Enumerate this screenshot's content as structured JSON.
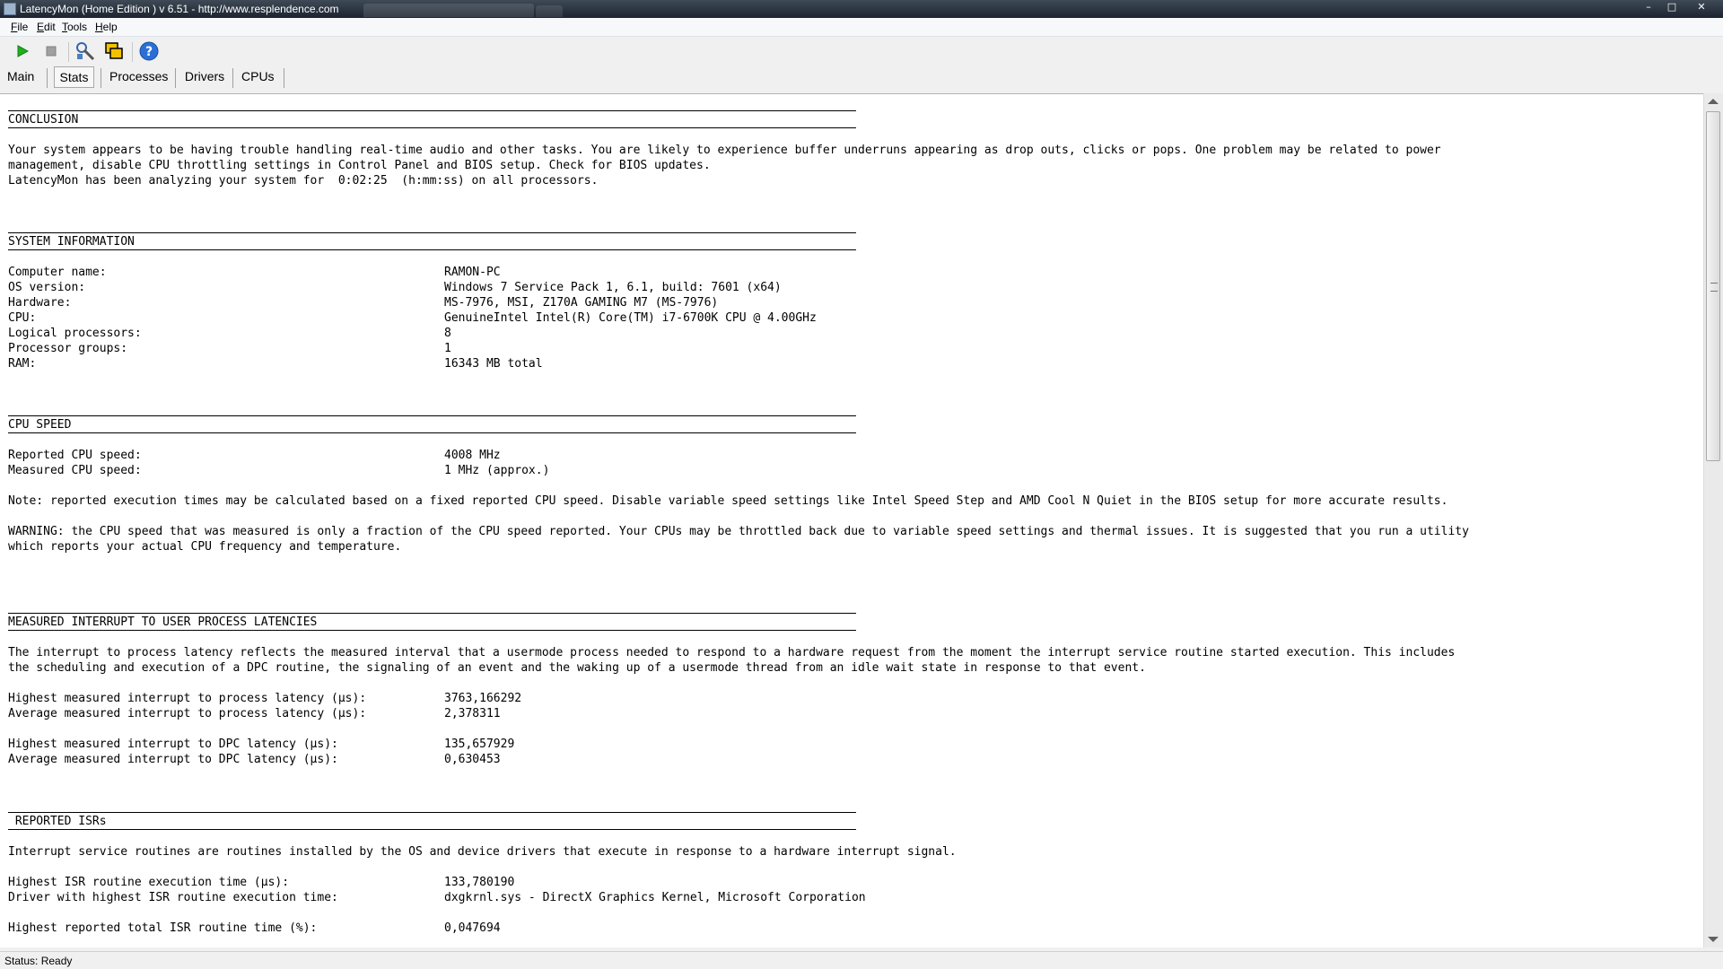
{
  "window": {
    "title": "LatencyMon  (Home Edition )  v 6.51 - http://www.resplendence.com",
    "controls": {
      "minimize": "–",
      "maximize": "□",
      "close": "✕"
    }
  },
  "menu": [
    {
      "label": "File"
    },
    {
      "label": "Edit"
    },
    {
      "label": "Tools"
    },
    {
      "label": "Help"
    }
  ],
  "toolbar": {
    "icons": [
      "play-icon",
      "stop-icon",
      "tools-icon",
      "windows-icon",
      "help-icon"
    ],
    "play_color": "#1fae1f",
    "help_color": "#2b6fd6"
  },
  "tabs": [
    {
      "label": "Main",
      "active": false
    },
    {
      "label": "Stats",
      "active": true
    },
    {
      "label": "Processes",
      "active": false
    },
    {
      "label": "Drivers",
      "active": false
    },
    {
      "label": "CPUs",
      "active": false
    }
  ],
  "report": {
    "conclusion": {
      "heading": "CONCLUSION",
      "line1": "Your system appears to be having trouble handling real-time audio and other tasks. You are likely to experience buffer underruns appearing as drop outs, clicks or pops. One problem may be related to power",
      "line2": "management, disable CPU throttling settings in Control Panel and BIOS setup. Check for BIOS updates.",
      "line3": "LatencyMon has been analyzing your system for  0:02:25  (h:mm:ss) on all processors."
    },
    "system_information": {
      "heading": "SYSTEM INFORMATION",
      "rows": [
        {
          "label": "Computer name:",
          "value": "RAMON-PC"
        },
        {
          "label": "OS version:",
          "value": "Windows 7 Service Pack 1, 6.1, build: 7601 (x64)"
        },
        {
          "label": "Hardware:",
          "value": "MS-7976, MSI, Z170A GAMING M7 (MS-7976)"
        },
        {
          "label": "CPU:",
          "value": "GenuineIntel Intel(R) Core(TM) i7-6700K CPU @ 4.00GHz"
        },
        {
          "label": "Logical processors:",
          "value": "8"
        },
        {
          "label": "Processor groups:",
          "value": "1"
        },
        {
          "label": "RAM:",
          "value": "16343 MB total"
        }
      ]
    },
    "cpu_speed": {
      "heading": "CPU SPEED",
      "rows": [
        {
          "label": "Reported CPU speed:",
          "value": "4008 MHz"
        },
        {
          "label": "Measured CPU speed:",
          "value": "1 MHz (approx.)"
        }
      ],
      "note": "Note: reported execution times may be calculated based on a fixed reported CPU speed. Disable variable speed settings like Intel Speed Step and AMD Cool N Quiet in the BIOS setup for more accurate results.",
      "warning1": "WARNING: the CPU speed that was measured is only a fraction of the CPU speed reported. Your CPUs may be throttled back due to variable speed settings and thermal issues. It is suggested that you run a utility",
      "warning2": "which reports your actual CPU frequency and temperature."
    },
    "interrupt_latencies": {
      "heading": "MEASURED INTERRUPT TO USER PROCESS LATENCIES",
      "desc1": "The interrupt to process latency reflects the measured interval that a usermode process needed to respond to a hardware request from the moment the interrupt service routine started execution. This includes",
      "desc2": "the scheduling and execution of a DPC routine, the signaling of an event and the waking up of a usermode thread from an idle wait state in response to that event.",
      "rows_process": [
        {
          "label": "Highest measured interrupt to process latency (µs):",
          "value": "3763,166292"
        },
        {
          "label": "Average measured interrupt to process latency (µs):",
          "value": "2,378311"
        }
      ],
      "rows_dpc": [
        {
          "label": "Highest measured interrupt to DPC latency (µs):",
          "value": "135,657929"
        },
        {
          "label": "Average measured interrupt to DPC latency (µs):",
          "value": "0,630453"
        }
      ]
    },
    "reported_isrs": {
      "heading": " REPORTED ISRs",
      "desc": "Interrupt service routines are routines installed by the OS and device drivers that execute in response to a hardware interrupt signal.",
      "rows": [
        {
          "label": "Highest ISR routine execution time (µs):",
          "value": "133,780190"
        },
        {
          "label": "Driver with highest ISR routine execution time:",
          "value": "dxgkrnl.sys - DirectX Graphics Kernel, Microsoft Corporation"
        }
      ],
      "total_row": {
        "label": "Highest reported total ISR routine time (%):",
        "value": "0,047694"
      }
    }
  },
  "status": "Status: Ready"
}
